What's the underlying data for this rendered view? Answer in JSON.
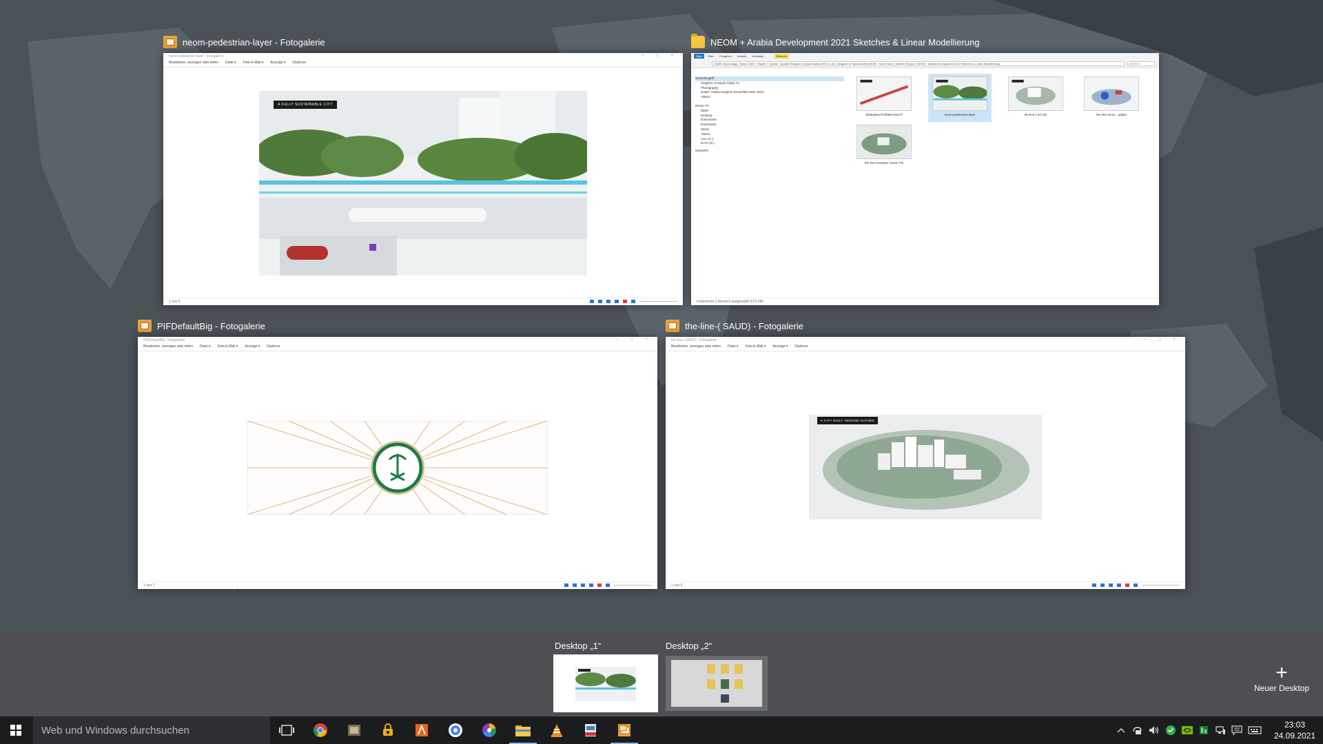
{
  "windows": [
    {
      "id": "pedestrian",
      "caption": "neom-pedestrian-layer - Fotogalerie",
      "window_title": "neom-pedestrian-layer - Fotogalerie",
      "commands": [
        "Bearbeiten, anzeigen oder teilen",
        "Datei ▾",
        "Foto-E-Mail ▾",
        "Anzeige ▾",
        "Diashow"
      ],
      "status": "1 von 5",
      "photo_label": "A FULLY SUSTAINABLE CITY"
    },
    {
      "id": "explorer",
      "caption": "NEOM + Arabia Development 2021 Sketches & Linear Modellierung",
      "ribbon_tabs": [
        "Datei",
        "Start",
        "Freigeben",
        "Ansicht",
        "Verwalten"
      ],
      "contextual_tab": "Bildtools",
      "address": "SABE Geoecology › Vision 2030 + Riyadh + Update › Update Kingdom of Saudi Arabia 2021 11.08 › Kingdom of Saudi Arabia NEOM › New Future | Modern Region › NEOM + Arabia Development 2021 Sketches & Linear Modellierung",
      "search_placeholder": "NEOM +...",
      "nav": [
        "Schnellzugriff",
        "Kingdom of Saudi Arabia 74",
        "Photography",
        "SABIC Arabia Kingdom Brownfield 2021-2023",
        "Videos",
        "Dieser PC",
        "Bilder",
        "Desktop",
        "Dokumente",
        "Downloads",
        "Musik",
        "Videos",
        "Acer (C:)",
        "DATA (D:)",
        "Netzwerk"
      ],
      "files": [
        "bb88a6bcef74f0b6740ac7f",
        "neom-pedestrian-layer",
        "the-line-( SAUD)",
        "the-line-neom _arabia",
        "the-line-revealed- 9154c77b"
      ],
      "status": "5 Elemente    1 Element ausgewählt (673 KB)"
    },
    {
      "id": "pif",
      "caption": "PIFDefaultBig - Fotogalerie",
      "window_title": "PIFDefaultBig - Fotogalerie",
      "commands": [
        "Bearbeiten, anzeigen oder teilen",
        "Datei ▾",
        "Foto-E-Mail ▾",
        "Anzeige ▾",
        "Diashow"
      ],
      "status": "1 von 2"
    },
    {
      "id": "saud",
      "caption": "the-line-( SAUD) - Fotogalerie",
      "window_title": "the-line-( SAUD) - Fotogalerie",
      "commands": [
        "Bearbeiten, anzeigen oder teilen",
        "Datei ▾",
        "Foto-E-Mail ▾",
        "Anzeige ▾",
        "Diashow"
      ],
      "status": "1 von 5",
      "photo_label": "A CITY BUILT AROUND NATURE"
    }
  ],
  "desktops": [
    {
      "label": "Desktop „1“",
      "active": true
    },
    {
      "label": "Desktop „2“",
      "active": false
    }
  ],
  "new_desktop": {
    "symbol": "+",
    "label": "Neuer Desktop"
  },
  "taskbar": {
    "search_placeholder": "Web und Windows durchsuchen",
    "icons": [
      "task-view-icon",
      "chrome-icon",
      "file-tool-icon",
      "security-icon",
      "adobe-icon",
      "chrome-alt-icon",
      "picasa-icon",
      "file-explorer-icon",
      "vlc-icon",
      "pdf-icon",
      "photo-gallery-icon"
    ],
    "time": "23:03",
    "date": "24.09.2021"
  },
  "colors": {
    "wallpaper": "#4b5258",
    "strip": "#4e4f52",
    "taskbar": "#1b1c1e",
    "accent": "#2b73c9"
  }
}
